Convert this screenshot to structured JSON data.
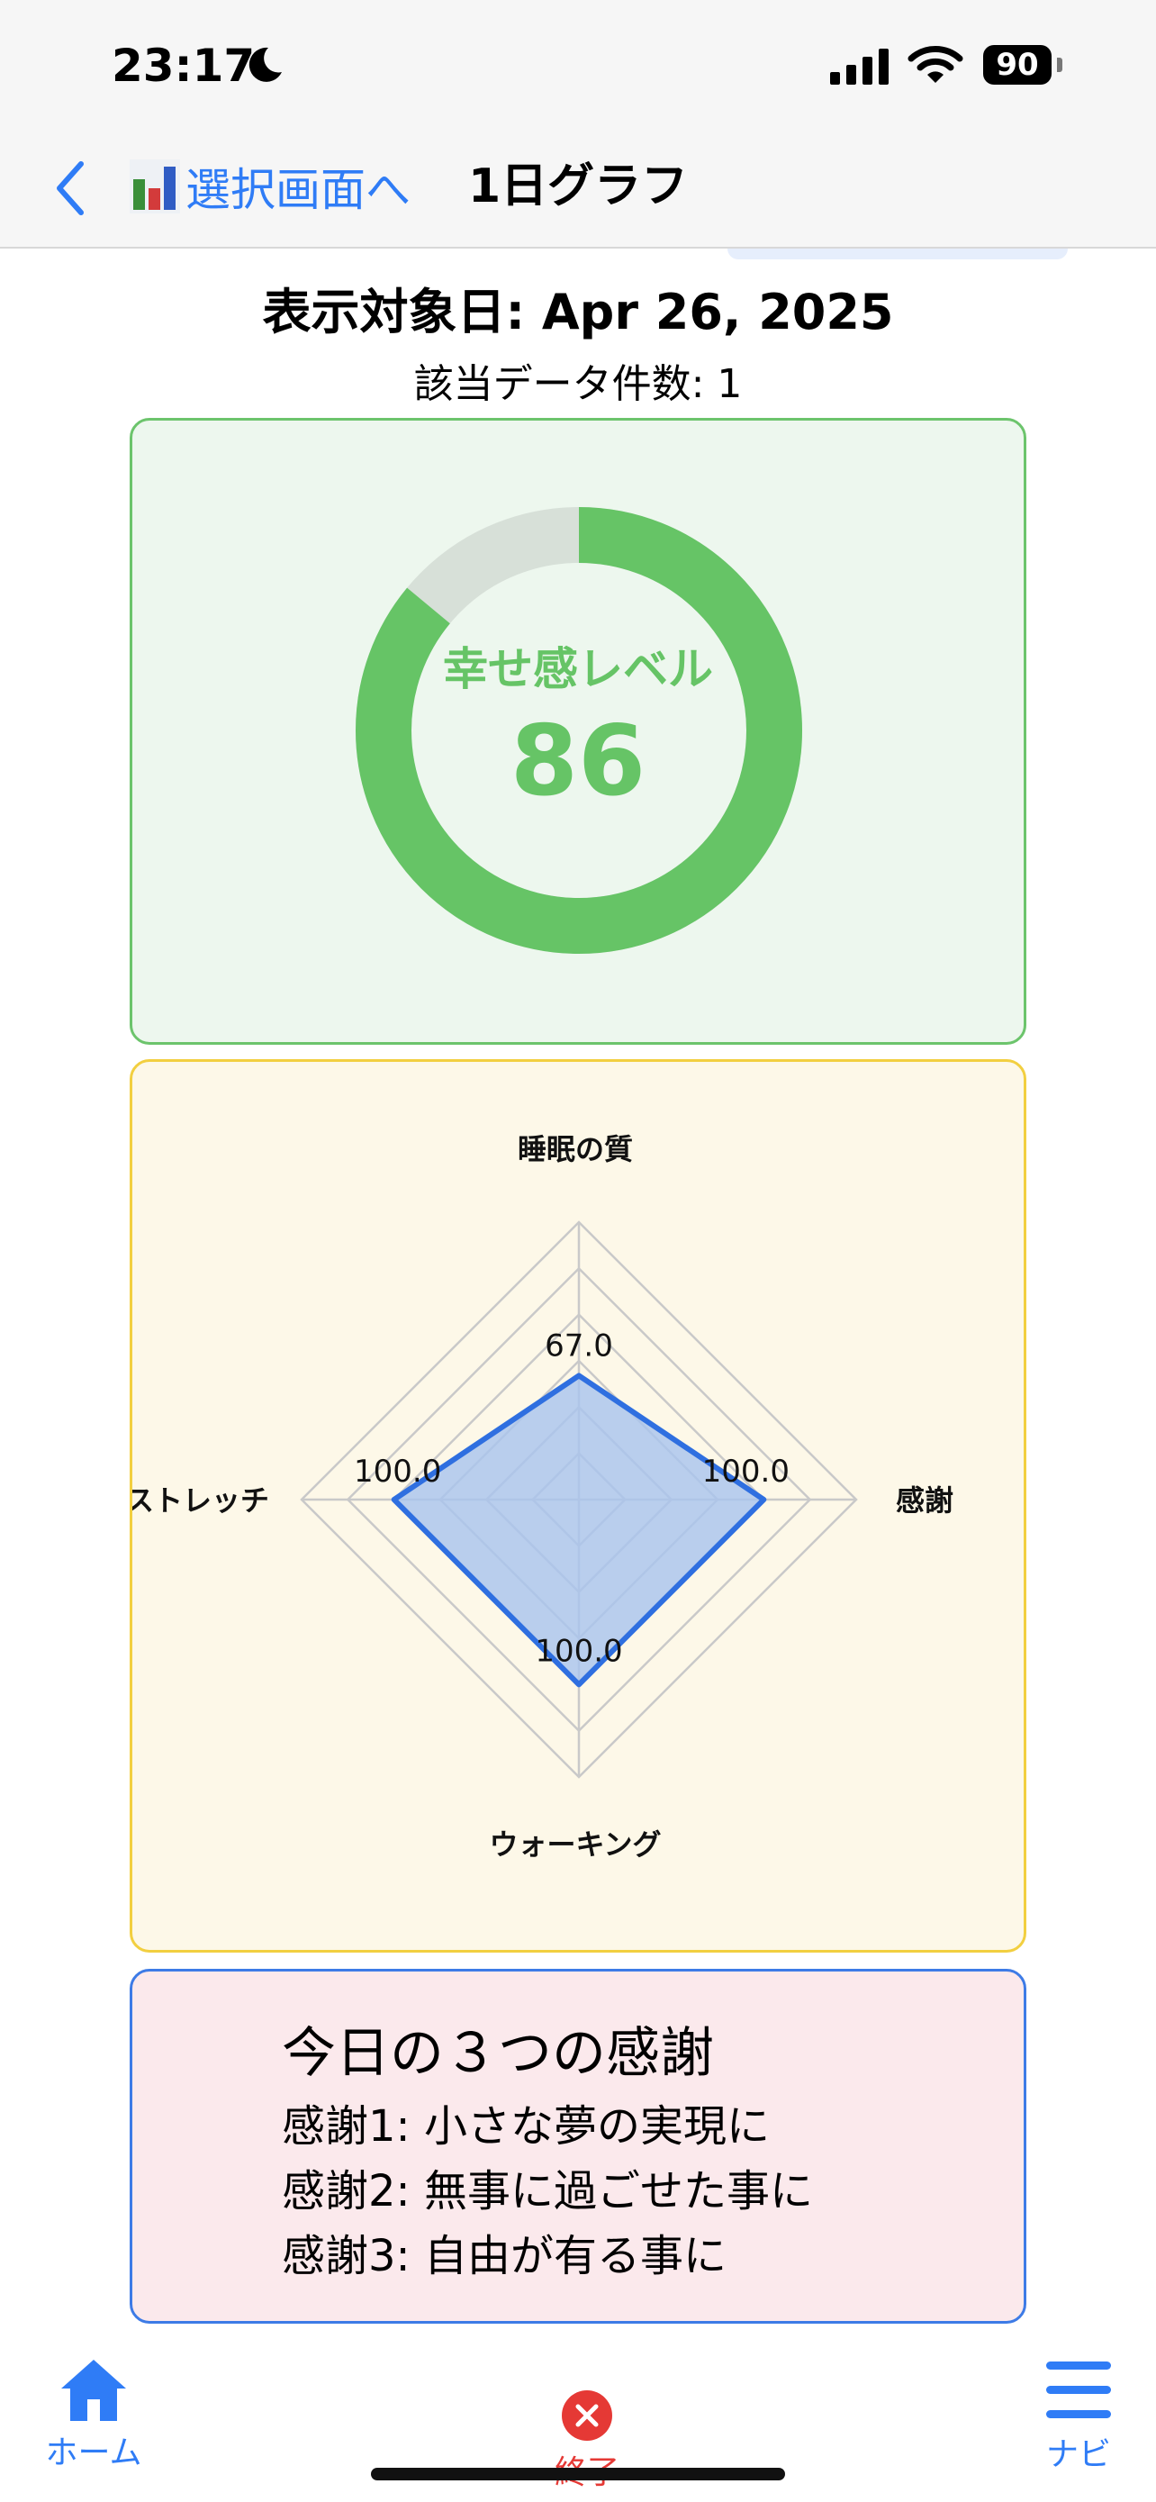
{
  "status_bar": {
    "time": "23:17",
    "battery": "90"
  },
  "nav": {
    "back_label": "選択画面へ",
    "title": "1日グラフ"
  },
  "header": {
    "date_label": "表示対象日: Apr 26, 2025",
    "count_label": "該当データ件数: 1"
  },
  "happiness": {
    "label": "幸せ感レベル",
    "value": "86",
    "percent": 86,
    "fill_color": "#66c466",
    "track_color": "#d7e0d8"
  },
  "chart_data": {
    "type": "radar",
    "axes": [
      "睡眠の質",
      "感謝",
      "ウォーキング",
      "ストレッチ"
    ],
    "axis_display": [
      "睡眠の質",
      "感謝",
      "ウォーキング",
      "ストレッチ"
    ],
    "values": [
      67.0,
      100.0,
      100.0,
      100.0
    ],
    "value_labels": [
      "67.0",
      "100.0",
      "100.0",
      "100.0"
    ],
    "max": 150,
    "rings": 6,
    "line_color": "#2f6fe0",
    "fill_color": "#a9c4ee"
  },
  "gratitude": {
    "heading": "今日の３つの感謝",
    "items": [
      "感謝1:  小さな夢の実現に",
      "感謝2:  無事に過ごせた事に",
      "感謝3:  自由が有る事に"
    ]
  },
  "tabs": {
    "home": "ホーム",
    "exit": "終了",
    "navi": "ナビ"
  },
  "colors": {
    "accent": "#2f7cf6",
    "danger": "#e53935"
  }
}
